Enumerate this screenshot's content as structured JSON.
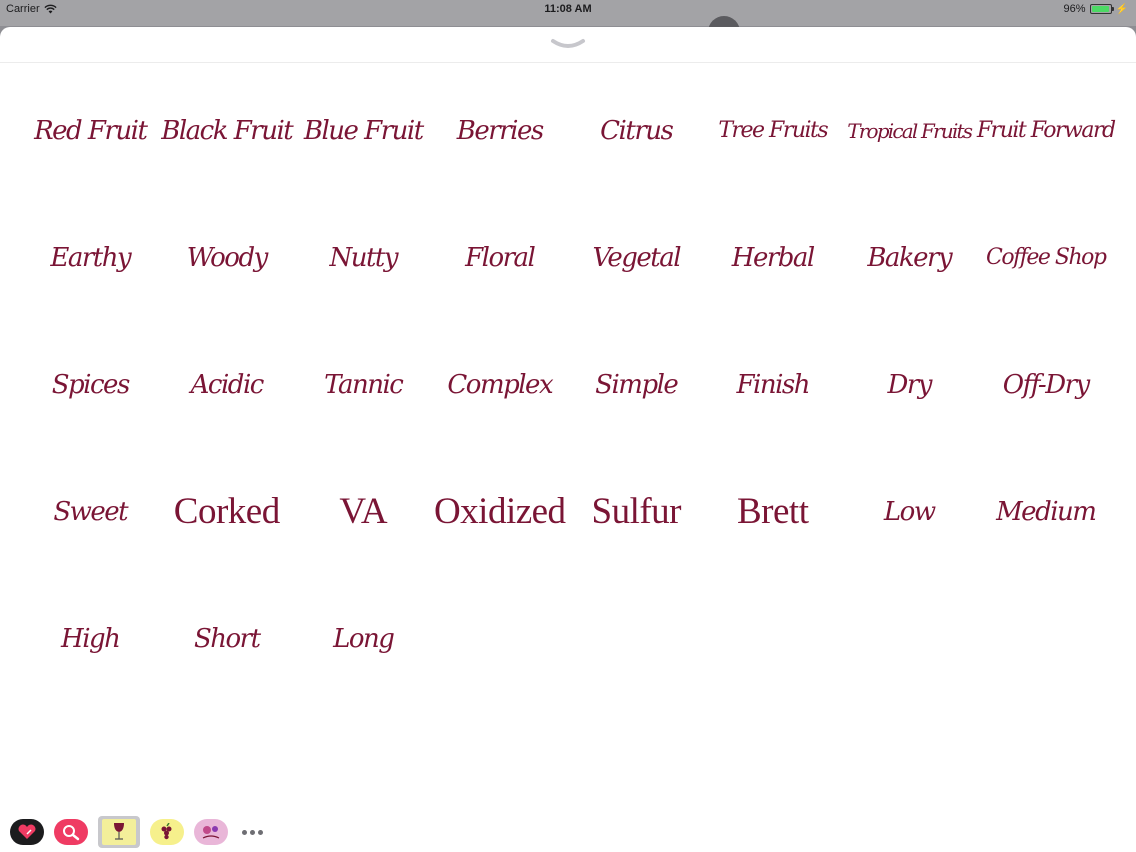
{
  "status_bar": {
    "carrier": "Carrier",
    "time": "11:08 AM",
    "battery": "96%",
    "battery_level": 0.96
  },
  "stickers": [
    {
      "label": "Red Fruit",
      "style": "script"
    },
    {
      "label": "Black Fruit",
      "style": "script"
    },
    {
      "label": "Blue Fruit",
      "style": "script"
    },
    {
      "label": "Berries",
      "style": "script"
    },
    {
      "label": "Citrus",
      "style": "script"
    },
    {
      "label": "Tree Fruits",
      "style": "script small"
    },
    {
      "label": "Tropical Fruits",
      "style": "script xsmall"
    },
    {
      "label": "Fruit Forward",
      "style": "script small"
    },
    {
      "label": "Earthy",
      "style": "script"
    },
    {
      "label": "Woody",
      "style": "script"
    },
    {
      "label": "Nutty",
      "style": "script"
    },
    {
      "label": "Floral",
      "style": "script"
    },
    {
      "label": "Vegetal",
      "style": "script"
    },
    {
      "label": "Herbal",
      "style": "script"
    },
    {
      "label": "Bakery",
      "style": "script"
    },
    {
      "label": "Coffee Shop",
      "style": "script small"
    },
    {
      "label": "Spices",
      "style": "script"
    },
    {
      "label": "Acidic",
      "style": "script"
    },
    {
      "label": "Tannic",
      "style": "script"
    },
    {
      "label": "Complex",
      "style": "script"
    },
    {
      "label": "Simple",
      "style": "script"
    },
    {
      "label": "Finish",
      "style": "script"
    },
    {
      "label": "Dry",
      "style": "script"
    },
    {
      "label": "Off-Dry",
      "style": "script"
    },
    {
      "label": "Sweet",
      "style": "script"
    },
    {
      "label": "Corked",
      "style": "serif"
    },
    {
      "label": "VA",
      "style": "serif"
    },
    {
      "label": "Oxidized",
      "style": "serif"
    },
    {
      "label": "Sulfur",
      "style": "serif"
    },
    {
      "label": "Brett",
      "style": "serif"
    },
    {
      "label": "Low",
      "style": "script"
    },
    {
      "label": "Medium",
      "style": "script"
    },
    {
      "label": "High",
      "style": "script"
    },
    {
      "label": "Short",
      "style": "script"
    },
    {
      "label": "Long",
      "style": "script"
    }
  ],
  "tray": {
    "apps": [
      {
        "icon": "heart-sticker-app-icon",
        "bg": "#1c1c1e",
        "selected": false
      },
      {
        "icon": "magnifier-app-icon",
        "bg": "#ef3b63",
        "selected": false
      },
      {
        "icon": "wine-glass-app-icon",
        "bg": "#f3ef9a",
        "selected": true
      },
      {
        "icon": "grapes-app-icon",
        "bg": "#f6f08c",
        "selected": false
      },
      {
        "icon": "floral-sticker-app-icon",
        "bg": "#e9b6d8",
        "selected": false
      }
    ]
  },
  "colors": {
    "sticker_text": "#7a1535",
    "accent_pink": "#ef3b63"
  }
}
